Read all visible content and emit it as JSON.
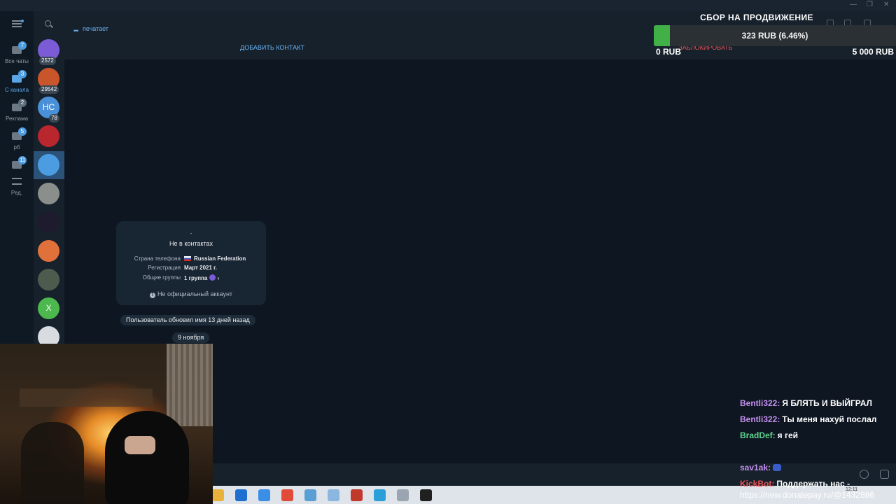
{
  "window": {
    "controls": [
      "—",
      "❐",
      "✕"
    ]
  },
  "folders": {
    "items": [
      {
        "label": "Все чаты",
        "badge": "7",
        "active": false
      },
      {
        "label": "С канала",
        "badge": "3",
        "active": true
      },
      {
        "label": "Реклама",
        "badge": "2",
        "active": false
      },
      {
        "label": "рб",
        "badge": "5",
        "active": false
      },
      {
        "label": "",
        "badge": "11",
        "active": false
      }
    ],
    "edit_label": "Ред."
  },
  "chatlist": {
    "items": [
      {
        "badge": "2572",
        "color": "#7b5cd6",
        "text": ""
      },
      {
        "badge": "29542",
        "color": "#c9552a",
        "text": ""
      },
      {
        "badge": "78",
        "color": "#4a90d9",
        "text": "НС"
      },
      {
        "badge": "",
        "color": "#b8262e",
        "text": ""
      },
      {
        "badge": "",
        "color": "#4c9ce2",
        "text": ""
      },
      {
        "badge": "",
        "color": "#8a8f8c",
        "text": ""
      },
      {
        "badge": "",
        "color": "#1f1b2e",
        "text": ""
      },
      {
        "badge": "",
        "color": "#e0713a",
        "text": ""
      },
      {
        "badge": "",
        "color": "#4d5b4f",
        "text": ""
      },
      {
        "badge": "",
        "color": "#4cb84d",
        "text": "X"
      },
      {
        "badge": "",
        "color": "#d8dbe0",
        "text": ""
      }
    ]
  },
  "header": {
    "status": "печатает",
    "add_contact": "ДОБАВИТЬ КОНТАКТ",
    "block": "ЗАБЛОКИРОВАТЬ"
  },
  "info_card": {
    "name": ".",
    "title": "Не в контактах",
    "rows": [
      {
        "label": "Страна телефона",
        "value": "Russian Federation"
      },
      {
        "label": "Регистрация",
        "value": "Март 2021 г."
      },
      {
        "label": "Общие группы",
        "value": "1 группа"
      }
    ],
    "note": "Не официальный аккаунт"
  },
  "service": {
    "name_update": "Пользователь обновил имя 13 дней назад",
    "date": "9 ноября"
  },
  "donation": {
    "title": "СБОР НА ПРОДВИЖЕНИЕ",
    "amount": "323 RUB (6.46%)",
    "progress": 0.0646,
    "min": "0 RUB",
    "max": "5 000 RUB"
  },
  "stream_chat": {
    "messages": [
      {
        "nick": "Bentli322:",
        "text": "Я БЛЯТЬ И ВЫЙГРАЛ",
        "color": "#c58ff0"
      },
      {
        "nick": "Bentli322:",
        "text": "Ты меня нахуй послал",
        "color": "#c58ff0"
      },
      {
        "nick": "BradDef:",
        "text": "я гей",
        "color": "#5fd38d"
      },
      {
        "nick": "sav1ak:",
        "text": "",
        "color": "#c58ff0"
      },
      {
        "nick": "KickBot:",
        "text": "Поддержать нас -",
        "color": "#e5555a"
      }
    ],
    "url": "https://new.donatepay.ru/@1432886"
  },
  "taskbar": {
    "icons": [
      "file-explorer",
      "outlook",
      "photos",
      "chrome",
      "notes",
      "paint",
      "bug-app",
      "telegram",
      "gallery",
      "obs"
    ],
    "clock": "12:11"
  }
}
